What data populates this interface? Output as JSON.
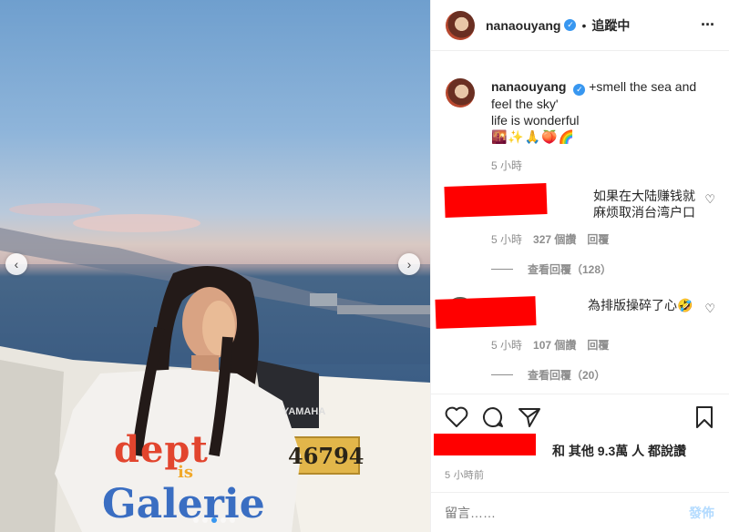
{
  "post": {
    "username": "nanaouyang",
    "separator": "•",
    "follow_status": "追蹤中",
    "more": "···"
  },
  "caption": {
    "username": "nanaouyang",
    "line1": "+smell the sea and",
    "line2": "feel the sky'",
    "line3": "life is wonderful",
    "emojis": "🌇✨🙏🍑🌈",
    "time": "5 小時"
  },
  "comments": [
    {
      "text": "如果在大陆赚钱就麻烦取消台湾户口",
      "time": "5 小時",
      "likes": "327 個讚",
      "reply": "回覆",
      "view_replies": "查看回覆（128）"
    },
    {
      "text": "為排版操碎了心🤣",
      "time": "5 小時",
      "likes": "107 個讚",
      "reply": "回覆",
      "view_replies": "查看回覆（20）"
    }
  ],
  "likes_line": "和 其他 9.3萬 人 都說讚",
  "posted_ago": "5 小時前",
  "comment_box": {
    "placeholder": "留言……",
    "post_label": "發佈"
  },
  "photo": {
    "boat_number": "46794",
    "engine_brand": "YAMAHA",
    "shirt_text_1": "dept",
    "shirt_text_2": "is",
    "shirt_text_3": "Galerie",
    "slide_count": 5,
    "active_slide": 3
  },
  "icons": {
    "prev": "‹",
    "next": "›",
    "heart": "♡",
    "verified": "✓"
  },
  "colors": {
    "verified": "#3897f0",
    "redaction": "#ff0000",
    "post_button": "#b3dbff"
  }
}
